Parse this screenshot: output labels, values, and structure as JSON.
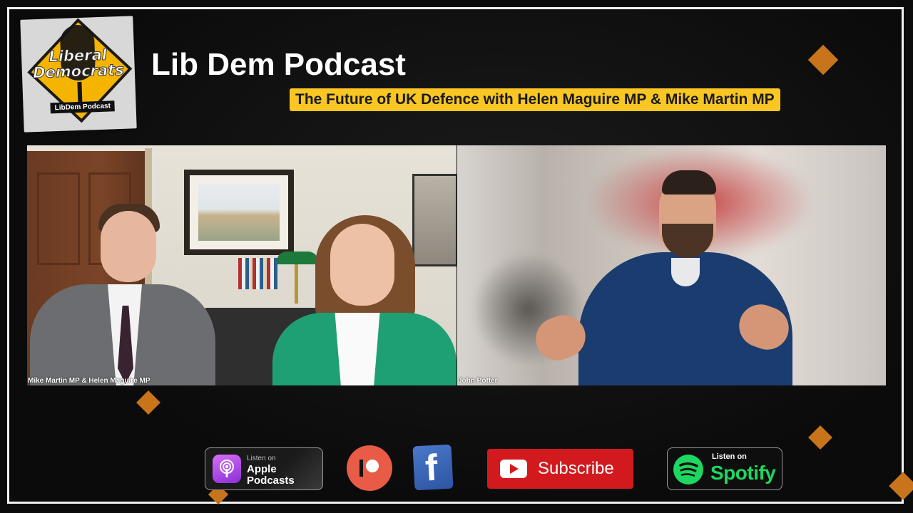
{
  "logo": {
    "lettering": "Liberal Democrats",
    "caption": "LibDem Podcast"
  },
  "header": {
    "title": "Lib Dem Podcast",
    "subtitle": "The Future of UK Defence with Helen Maguire MP & Mike Martin MP"
  },
  "videos": {
    "left": {
      "name_tag": "Mike Martin MP & Helen Maguire MP"
    },
    "right": {
      "name_tag": "John Potter"
    }
  },
  "links": {
    "apple": {
      "small": "Listen on",
      "big": "Apple Podcasts",
      "icon": "apple-podcasts-icon"
    },
    "patreon": {
      "icon": "patreon-icon"
    },
    "facebook": {
      "icon": "facebook-icon",
      "glyph": "f"
    },
    "youtube": {
      "label": "Subscribe",
      "icon": "youtube-icon"
    },
    "spotify": {
      "small": "Listen on",
      "big": "Spotify",
      "icon": "spotify-icon"
    }
  },
  "colors": {
    "accent_yellow": "#f9c623",
    "decor_orange": "#c8741b",
    "youtube_red": "#d21a1e",
    "spotify_green": "#1ed760",
    "patreon_coral": "#e85b46",
    "facebook_blue": "#3b5fb5"
  }
}
